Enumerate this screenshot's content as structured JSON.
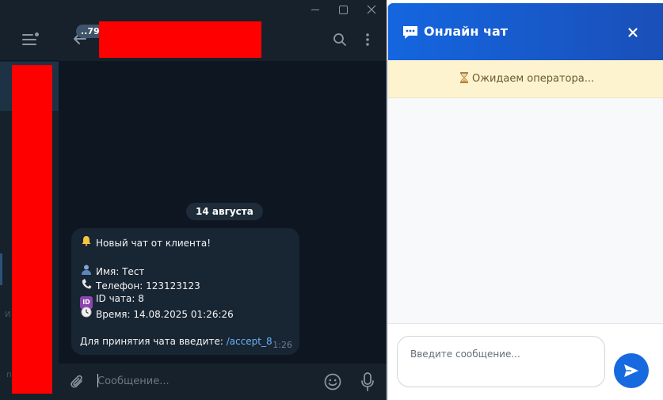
{
  "telegram": {
    "unread_count": "..79",
    "date_label": "14 августа",
    "message": {
      "title": "Новый чат от клиента!",
      "name_label": "Имя: Тест",
      "phone_label": "Телефон: 123123123",
      "chat_id_label": "ID чата: 8",
      "time_label": "Время: 14.08.2025 01:26:26",
      "instruction": "Для принятия чата введите:",
      "command": "/accept_8",
      "sent_time": "1:26",
      "icons": [
        "bell-icon",
        "user-icon",
        "phone-icon",
        "id-icon",
        "clock-icon"
      ]
    },
    "input_placeholder": "Сообщение...",
    "sidebar_faint_text": "И",
    "sidebar_faint_text2": "п",
    "colors": {
      "bg": "#0e1621",
      "panel": "#17212b",
      "bubble": "#182533",
      "link": "#6ab3f3",
      "redaction": "#ff0000"
    }
  },
  "widget": {
    "title": "Онлайн чат",
    "status": "Ожидаем оператора...",
    "input_placeholder": "Введите сообщение...",
    "colors": {
      "header": "#1a5fd0",
      "status_bg": "#fdf3cf",
      "send_button": "#1769e0"
    }
  }
}
